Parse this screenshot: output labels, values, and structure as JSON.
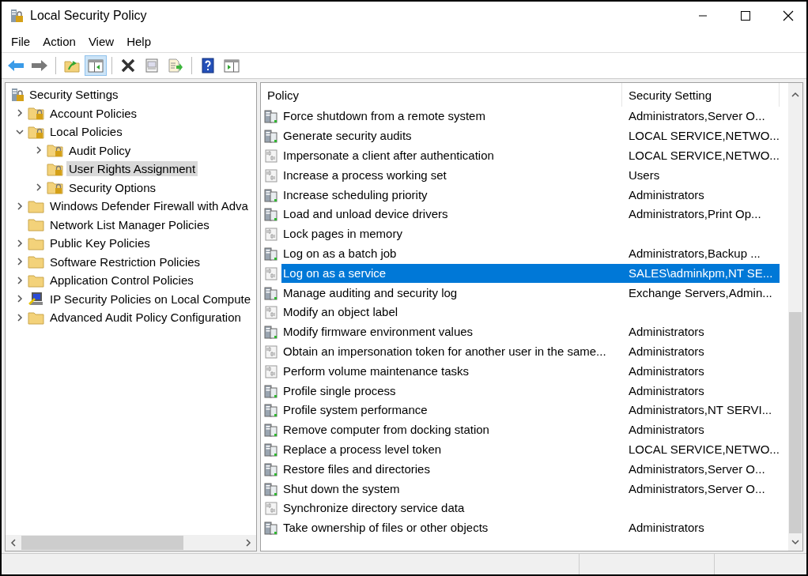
{
  "window": {
    "title": "Local Security Policy"
  },
  "menu": [
    "File",
    "Action",
    "View",
    "Help"
  ],
  "toolbar": [
    {
      "kind": "back",
      "pressed": false
    },
    {
      "kind": "forward",
      "pressed": false
    },
    {
      "kind": "separator"
    },
    {
      "kind": "up",
      "pressed": false
    },
    {
      "kind": "tree",
      "pressed": true
    },
    {
      "kind": "separator"
    },
    {
      "kind": "delete",
      "pressed": false
    },
    {
      "kind": "properties",
      "pressed": false
    },
    {
      "kind": "export",
      "pressed": false
    },
    {
      "kind": "separator"
    },
    {
      "kind": "help",
      "pressed": false
    },
    {
      "kind": "pane",
      "pressed": false
    }
  ],
  "tree": [
    {
      "label": "Security Settings",
      "kind": "root",
      "selected": false,
      "children": [
        {
          "label": "Account Policies",
          "kind": "folder-lock",
          "expanded": false,
          "selected": false
        },
        {
          "label": "Local Policies",
          "kind": "folder-lock",
          "expanded": true,
          "selected": false,
          "children": [
            {
              "label": "Audit Policy",
              "kind": "folder-lock",
              "expanded": false,
              "selected": false
            },
            {
              "label": "User Rights Assignment",
              "kind": "folder-lock",
              "selected": true
            },
            {
              "label": "Security Options",
              "kind": "folder-lock",
              "expanded": false,
              "selected": false
            }
          ]
        },
        {
          "label": "Windows Defender Firewall with Adva",
          "kind": "folder",
          "expanded": false,
          "selected": false
        },
        {
          "label": "Network List Manager Policies",
          "kind": "folder",
          "selected": false
        },
        {
          "label": "Public Key Policies",
          "kind": "folder",
          "expanded": false,
          "selected": false
        },
        {
          "label": "Software Restriction Policies",
          "kind": "folder",
          "expanded": false,
          "selected": false
        },
        {
          "label": "Application Control Policies",
          "kind": "folder",
          "expanded": false,
          "selected": false
        },
        {
          "label": "IP Security Policies on Local Compute",
          "kind": "ipsec",
          "expanded": false,
          "selected": false
        },
        {
          "label": "Advanced Audit Policy Configuration",
          "kind": "folder",
          "expanded": false,
          "selected": false
        }
      ]
    }
  ],
  "table": {
    "columns": [
      "Policy",
      "Security Setting"
    ],
    "rows": [
      {
        "policy": "Force shutdown from a remote system",
        "setting": "Administrators,Server O...",
        "kind": "server",
        "selected": false
      },
      {
        "policy": "Generate security audits",
        "setting": "LOCAL SERVICE,NETWO...",
        "kind": "server",
        "selected": false
      },
      {
        "policy": "Impersonate a client after authentication",
        "setting": "LOCAL SERVICE,NETWO...",
        "kind": "binary",
        "selected": false
      },
      {
        "policy": "Increase a process working set",
        "setting": "Users",
        "kind": "binary",
        "selected": false
      },
      {
        "policy": "Increase scheduling priority",
        "setting": "Administrators",
        "kind": "server",
        "selected": false
      },
      {
        "policy": "Load and unload device drivers",
        "setting": "Administrators,Print Op...",
        "kind": "server",
        "selected": false
      },
      {
        "policy": "Lock pages in memory",
        "kind": "binary",
        "selected": false
      },
      {
        "policy": "Log on as a batch job",
        "setting": "Administrators,Backup ...",
        "kind": "server",
        "selected": false
      },
      {
        "policy": "Log on as a service",
        "setting": "SALES\\adminkpm,NT SE...",
        "kind": "binary",
        "selected": true
      },
      {
        "policy": "Manage auditing and security log",
        "setting": "Exchange Servers,Admin...",
        "kind": "server",
        "selected": false
      },
      {
        "policy": "Modify an object label",
        "kind": "binary",
        "selected": false
      },
      {
        "policy": "Modify firmware environment values",
        "setting": "Administrators",
        "kind": "server",
        "selected": false
      },
      {
        "policy": "Obtain an impersonation token for another user in the same...",
        "setting": "Administrators",
        "kind": "binary",
        "selected": false
      },
      {
        "policy": "Perform volume maintenance tasks",
        "setting": "Administrators",
        "kind": "binary",
        "selected": false
      },
      {
        "policy": "Profile single process",
        "setting": "Administrators",
        "kind": "server",
        "selected": false
      },
      {
        "policy": "Profile system performance",
        "setting": "Administrators,NT SERVI...",
        "kind": "server",
        "selected": false
      },
      {
        "policy": "Remove computer from docking station",
        "setting": "Administrators",
        "kind": "server",
        "selected": false
      },
      {
        "policy": "Replace a process level token",
        "setting": "LOCAL SERVICE,NETWO...",
        "kind": "server",
        "selected": false
      },
      {
        "policy": "Restore files and directories",
        "setting": "Administrators,Server O...",
        "kind": "server",
        "selected": false
      },
      {
        "policy": "Shut down the system",
        "setting": "Administrators,Server O...",
        "kind": "server",
        "selected": false
      },
      {
        "policy": "Synchronize directory service data",
        "kind": "binary",
        "selected": false
      },
      {
        "policy": "Take ownership of files or other objects",
        "setting": "Administrators",
        "kind": "server",
        "selected": false
      }
    ]
  }
}
